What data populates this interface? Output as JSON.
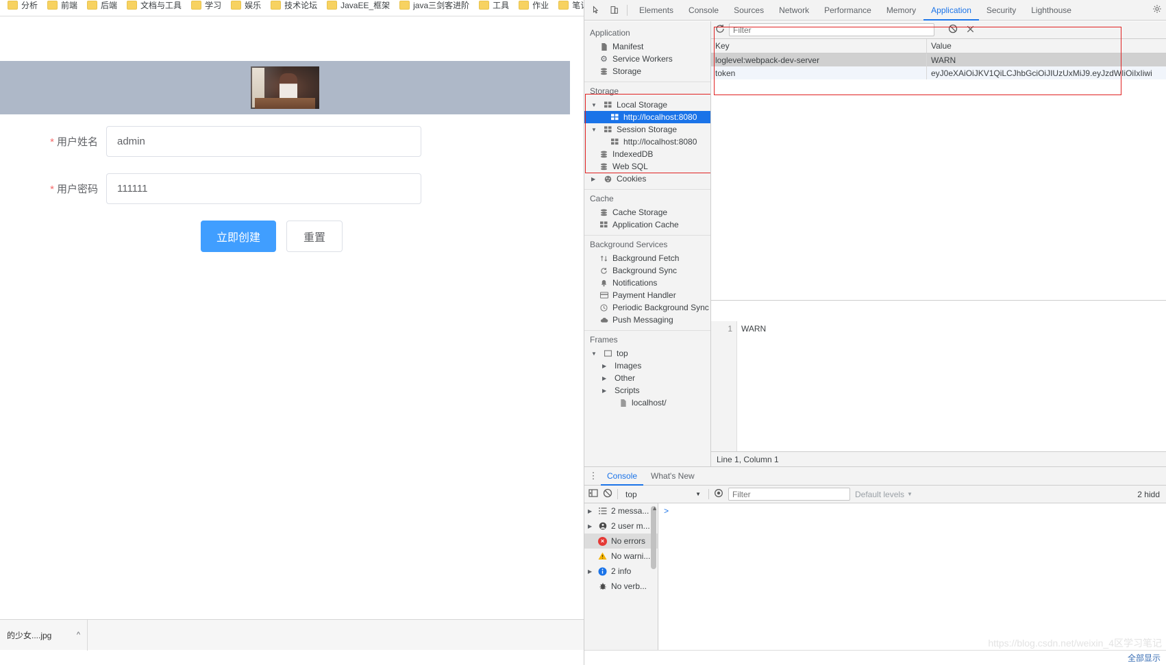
{
  "browser": {
    "bookmarks": [
      {
        "label": "分析"
      },
      {
        "label": "前端"
      },
      {
        "label": "后端"
      },
      {
        "label": "文档与工具"
      },
      {
        "label": "学习"
      },
      {
        "label": "娱乐"
      },
      {
        "label": "技术论坛"
      },
      {
        "label": "JavaEE_框架"
      },
      {
        "label": "java三剑客进阶"
      },
      {
        "label": "工具"
      },
      {
        "label": "作业"
      },
      {
        "label": "笔记"
      }
    ],
    "download": {
      "filename": "的少女....jpg",
      "chevron": "chevron-up-icon"
    }
  },
  "page": {
    "banner_image_alt": "girl-photo",
    "form": {
      "fields": [
        {
          "label": "用户姓名",
          "value": "admin",
          "required": true
        },
        {
          "label": "用户密码",
          "value": "111111",
          "required": true
        }
      ],
      "buttons": {
        "submit": "立即创建",
        "reset": "重置"
      }
    }
  },
  "devtools": {
    "toolbar": {
      "inspect_icon": "inspect-element-icon",
      "device_icon": "toggle-device-toolbar-icon",
      "settings_icon": "gear-icon",
      "tabs": [
        {
          "label": "Elements",
          "active": false
        },
        {
          "label": "Console",
          "active": false
        },
        {
          "label": "Sources",
          "active": false
        },
        {
          "label": "Network",
          "active": false
        },
        {
          "label": "Performance",
          "active": false
        },
        {
          "label": "Memory",
          "active": false
        },
        {
          "label": "Application",
          "active": true
        },
        {
          "label": "Security",
          "active": false
        },
        {
          "label": "Lighthouse",
          "active": false
        }
      ]
    },
    "sidebar": {
      "groups": [
        {
          "header": "Application",
          "items": [
            {
              "label": "Manifest",
              "icon": "manifest-icon",
              "indent": 1
            },
            {
              "label": "Service Workers",
              "icon": "gear-icon",
              "indent": 1
            },
            {
              "label": "Storage",
              "icon": "database-icon",
              "indent": 1
            }
          ]
        },
        {
          "header": "Storage",
          "items": [
            {
              "label": "Local Storage",
              "icon": "table-icon",
              "indent": 1,
              "twisty": "▼"
            },
            {
              "label": "http://localhost:8080",
              "icon": "table-icon",
              "indent": 2,
              "selected": true
            },
            {
              "label": "Session Storage",
              "icon": "table-icon",
              "indent": 1,
              "twisty": "▼"
            },
            {
              "label": "http://localhost:8080",
              "icon": "table-icon",
              "indent": 2
            },
            {
              "label": "IndexedDB",
              "icon": "database-icon",
              "indent": 1
            },
            {
              "label": "Web SQL",
              "icon": "database-icon",
              "indent": 1
            },
            {
              "label": "Cookies",
              "icon": "cookie-icon",
              "indent": 1,
              "twisty": "▶"
            }
          ]
        },
        {
          "header": "Cache",
          "items": [
            {
              "label": "Cache Storage",
              "icon": "database-icon",
              "indent": 1
            },
            {
              "label": "Application Cache",
              "icon": "table-icon",
              "indent": 1
            }
          ]
        },
        {
          "header": "Background Services",
          "items": [
            {
              "label": "Background Fetch",
              "icon": "fetch-arrows-icon",
              "indent": 1
            },
            {
              "label": "Background Sync",
              "icon": "sync-icon",
              "indent": 1
            },
            {
              "label": "Notifications",
              "icon": "bell-icon",
              "indent": 1
            },
            {
              "label": "Payment Handler",
              "icon": "credit-card-icon",
              "indent": 1
            },
            {
              "label": "Periodic Background Sync",
              "icon": "clock-icon",
              "indent": 1
            },
            {
              "label": "Push Messaging",
              "icon": "cloud-icon",
              "indent": 1
            }
          ]
        },
        {
          "header": "Frames",
          "items": [
            {
              "label": "top",
              "icon": "frame-icon",
              "indent": 1,
              "twisty": "▼"
            },
            {
              "label": "Images",
              "icon": "",
              "indent": 2,
              "twisty": "▶"
            },
            {
              "label": "Other",
              "icon": "",
              "indent": 2,
              "twisty": "▶"
            },
            {
              "label": "Scripts",
              "icon": "",
              "indent": 2,
              "twisty": "▶"
            },
            {
              "label": "localhost/",
              "icon": "document-icon",
              "indent": 3
            }
          ]
        }
      ]
    },
    "storage_view": {
      "refresh_icon": "refresh-icon",
      "filter_placeholder": "Filter",
      "clear_all_icon": "clear-all-icon",
      "delete_selected_icon": "delete-icon",
      "columns": [
        "Key",
        "Value"
      ],
      "rows": [
        {
          "key": "loglevel:webpack-dev-server",
          "value": "WARN",
          "selected": true
        },
        {
          "key": "token",
          "value": "eyJ0eXAiOiJKV1QiLCJhbGciOiJIUzUxMiJ9.eyJzdWIiOiIxIiwi",
          "selected": false
        }
      ],
      "preview": {
        "line_number": "1",
        "text": "WARN"
      },
      "status": "Line 1, Column 1"
    },
    "drawer": {
      "kebab_icon": "more-options-icon",
      "tabs": [
        {
          "label": "Console",
          "active": true
        },
        {
          "label": "What's New",
          "active": false
        }
      ],
      "console_toolbar": {
        "sidebar_toggle_icon": "show-console-sidebar-icon",
        "clear_icon": "clear-console-icon",
        "context": "top",
        "context_caret": "▼",
        "eye_icon": "live-expression-icon",
        "filter_placeholder": "Filter",
        "levels_label": "Default levels",
        "levels_caret": "▼",
        "hidden_label": "2 hidd"
      },
      "sidebar_items": [
        {
          "label": "2 messa...",
          "icon": "messages-icon",
          "twisty": "▶"
        },
        {
          "label": "2 user m...",
          "icon": "user-messages-icon",
          "twisty": "▶"
        },
        {
          "label": "No errors",
          "icon": "error-icon",
          "twisty": "",
          "selected": true
        },
        {
          "label": "No warni...",
          "icon": "warning-icon",
          "twisty": ""
        },
        {
          "label": "2 info",
          "icon": "info-icon",
          "twisty": "▶"
        },
        {
          "label": "No verb...",
          "icon": "verbose-icon",
          "twisty": ""
        }
      ],
      "prompt": ">"
    }
  },
  "watermark": {
    "text": "https://blog.csdn.net/weixin_4区学习笔记",
    "bottom_right": "全部显示"
  },
  "colors": {
    "accent_blue": "#1a73e8",
    "primary_button": "#409eff",
    "banner": "#aeb8c8",
    "highlight_box": "#e02020",
    "required_star": "#f56c6c"
  }
}
